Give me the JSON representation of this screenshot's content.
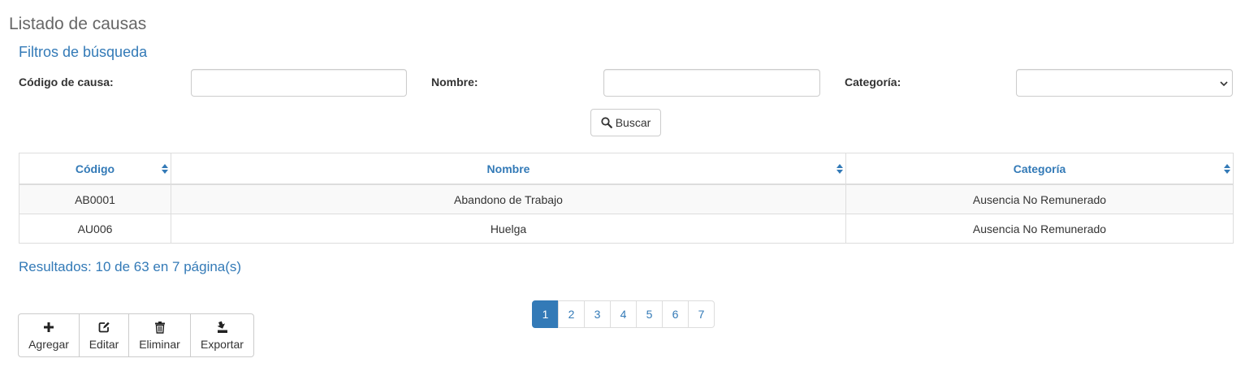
{
  "page_title": "Listado de causas",
  "filters": {
    "title": "Filtros de búsqueda",
    "codigo_label": "Código de causa:",
    "codigo_value": "",
    "nombre_label": "Nombre:",
    "nombre_value": "",
    "categoria_label": "Categoría:",
    "categoria_value": "",
    "search_button": "Buscar",
    "icons": {
      "search": "search-icon",
      "select": "chevron-down-icon"
    }
  },
  "table": {
    "columns": [
      "Código",
      "Nombre",
      "Categoría"
    ],
    "rows": [
      [
        "AB0001",
        "Abandono de Trabajo",
        "Ausencia No Remunerado"
      ],
      [
        "AU006",
        "Huelga",
        "Ausencia No Remunerado"
      ]
    ]
  },
  "results_text": "Resultados: 10 de 63 en 7 página(s)",
  "pagination": {
    "pages": [
      "1",
      "2",
      "3",
      "4",
      "5",
      "6",
      "7"
    ],
    "current": "1"
  },
  "toolbar": {
    "add": {
      "label": "Agregar",
      "icon": "plus-icon"
    },
    "edit": {
      "label": "Editar",
      "icon": "edit-icon"
    },
    "delete": {
      "label": "Eliminar",
      "icon": "trash-icon"
    },
    "export": {
      "label": "Exportar",
      "icon": "export-icon"
    }
  },
  "colors": {
    "primary": "#337ab7",
    "title": "#666666",
    "border": "#dddddd"
  }
}
